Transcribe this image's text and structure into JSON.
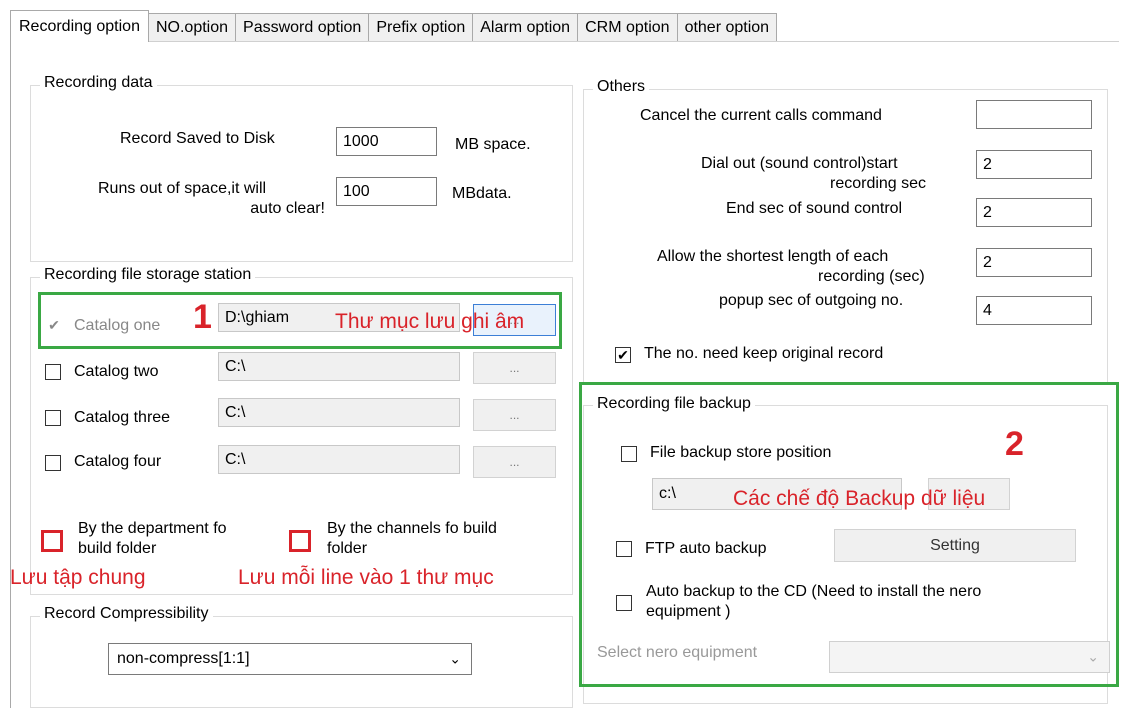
{
  "tabs": [
    "Recording option",
    "NO.option",
    "Password option",
    "Prefix option",
    "Alarm option",
    "CRM option",
    "other option"
  ],
  "recording_data": {
    "title": "Recording data",
    "saved_label": "Record Saved to Disk",
    "saved_value": "1000",
    "saved_unit": "MB space.",
    "runs_out_label_1": "Runs out of space,it will",
    "runs_out_label_2": "auto clear!",
    "runs_out_value": "100",
    "runs_out_unit": "MBdata."
  },
  "storage": {
    "title": "Recording file storage station",
    "catalogs": [
      {
        "label": "Catalog one",
        "path": "D:\\ghiam",
        "checked": "✔"
      },
      {
        "label": "Catalog two",
        "path": "C:\\"
      },
      {
        "label": "Catalog three",
        "path": "C:\\"
      },
      {
        "label": "Catalog four",
        "path": "C:\\"
      }
    ],
    "browse_label": "...",
    "dept_label_1": "By the department fo",
    "dept_label_2": "build folder",
    "channel_label_1": "By the channels fo build",
    "channel_label_2": "folder"
  },
  "compress": {
    "title": "Record Compressibility",
    "value": "non-compress[1:1]"
  },
  "others": {
    "title": "Others",
    "cancel_label": "Cancel the current calls command",
    "cancel_value": "",
    "dial_label_1": "Dial out (sound control)start",
    "dial_label_2": "recording sec",
    "dial_value": "2",
    "end_label": "End sec of sound control",
    "end_value": "2",
    "shortest_label_1": "Allow the shortest length of each",
    "shortest_label_2": "recording (sec)",
    "shortest_value": "2",
    "popup_label": "popup sec of outgoing no.",
    "popup_value": "4",
    "keep_label": "The no. need keep original record",
    "keep_checked": "✔"
  },
  "backup": {
    "title": "Recording file backup",
    "file_label": "File backup store position",
    "file_path": "c:\\",
    "ftp_label": "FTP auto backup",
    "setting_label": "Setting",
    "cd_label_1": "Auto backup to the CD (Need to install the nero",
    "cd_label_2": "equipment )",
    "nero_label": "Select nero equipment",
    "nero_value": ""
  },
  "annotations": {
    "num1": "1",
    "note1": "Thư mục lưu ghi âm",
    "num2": "2",
    "note2": "Các chế độ Backup dữ liệu",
    "note_dept": "Lưu tập chung",
    "note_channel": "Lưu mỗi line vào 1 thư mục"
  },
  "colors": {
    "annotation_red": "#d9232a",
    "annotation_green": "#3aa844"
  }
}
